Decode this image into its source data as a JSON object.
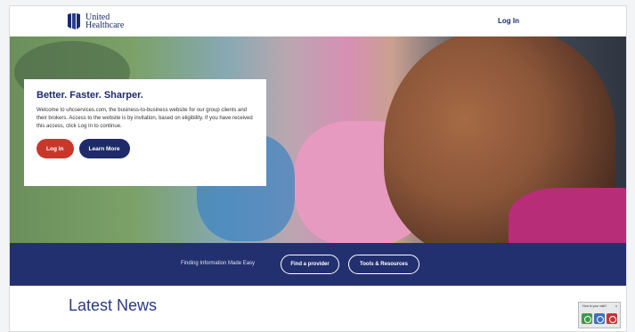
{
  "brand": {
    "line1": "United",
    "line2": "Healthcare"
  },
  "header": {
    "login_link": "Log In"
  },
  "hero": {
    "title": "Better. Faster. Sharper.",
    "body": "Welcome to uhcservices.com, the business-to-business website for our group clients and their brokers. Access to the website is by invitation, based on eligibility. If you have received this access, click Log In to continue.",
    "login_button": "Log In",
    "learn_button": "Learn More"
  },
  "quicklinks": {
    "tagline": "Finding Information Made Easy",
    "find_provider": "Find a provider",
    "tools": "Tools & Resources"
  },
  "news": {
    "title": "Latest News"
  },
  "feedback_widget": {
    "label": "How is your visit?",
    "close": "x"
  },
  "colors": {
    "brand_navy": "#23306f",
    "accent_red": "#c8382a",
    "text_navy": "#1b2a6b"
  }
}
